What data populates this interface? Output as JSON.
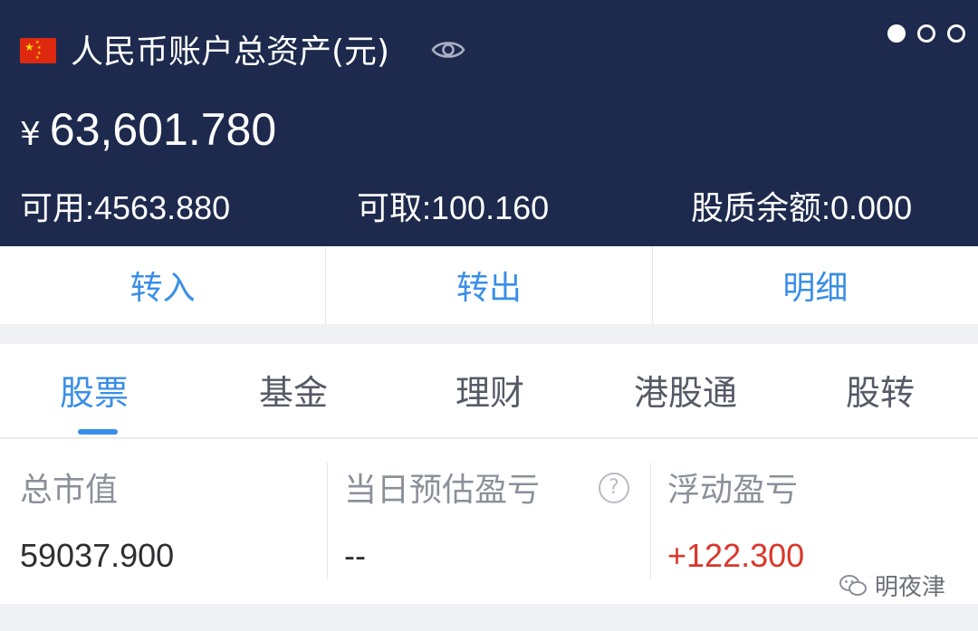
{
  "header": {
    "account_title": "人民币账户总资产(元)",
    "currency_symbol": "¥",
    "total_assets": "63,601.780",
    "available": "可用:4563.880",
    "withdrawable": "可取:100.160",
    "pledge_balance": "股质余额:0.000",
    "flag_icon": "china-flag-icon",
    "eye_icon": "eye-icon",
    "page_indicator": {
      "count": 3,
      "active_index": 0
    }
  },
  "actions": [
    {
      "label": "转入"
    },
    {
      "label": "转出"
    },
    {
      "label": "明细"
    }
  ],
  "tabs": [
    {
      "label": "股票",
      "active": true
    },
    {
      "label": "基金",
      "active": false
    },
    {
      "label": "理财",
      "active": false
    },
    {
      "label": "港股通",
      "active": false
    },
    {
      "label": "股转",
      "active": false
    }
  ],
  "summary": {
    "market_value_label": "总市值",
    "market_value": "59037.900",
    "daily_pnl_label": "当日预估盈亏",
    "daily_pnl": "--",
    "help_icon_text": "?",
    "floating_pnl_label": "浮动盈亏",
    "floating_pnl": "+122.300"
  },
  "watermark": {
    "text": "明夜津"
  },
  "colors": {
    "header_bg": "#1d2a4d",
    "accent_blue": "#3a8ee8",
    "profit_red": "#d9372b"
  }
}
